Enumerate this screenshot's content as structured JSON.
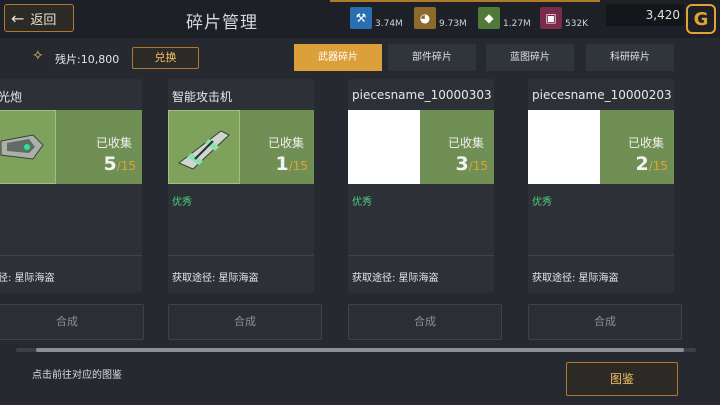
{
  "header": {
    "back_label": "返回",
    "title": "碎片管理",
    "resources": [
      {
        "icon": "wrench-icon",
        "value": "3.74M",
        "color": "#2a6fb0"
      },
      {
        "icon": "rock-icon",
        "value": "9.73M",
        "color": "#8b6a2a"
      },
      {
        "icon": "crystal-icon",
        "value": "1.27M",
        "color": "#4f7a3a"
      },
      {
        "icon": "cube-icon",
        "value": "532K",
        "color": "#7a2a4a"
      }
    ],
    "gold_value": "3,420",
    "gold_icon": "G"
  },
  "fragments": {
    "label": "残片:10,800",
    "exchange_label": "兑换"
  },
  "tabs": [
    {
      "label": "武器碎片",
      "active": true
    },
    {
      "label": "部件碎片",
      "active": false
    },
    {
      "label": "蓝图碎片",
      "active": false
    },
    {
      "label": "科研碎片",
      "active": false
    }
  ],
  "cards": [
    {
      "name": "光炮",
      "collected_label": "已收集",
      "count": "5",
      "total": "/15",
      "quality": "",
      "source": "径: 星际海盗",
      "synth_label": "合成"
    },
    {
      "name": "智能攻击机",
      "collected_label": "已收集",
      "count": "1",
      "total": "/15",
      "quality": "优秀",
      "source": "获取途径: 星际海盗",
      "synth_label": "合成"
    },
    {
      "name": "piecesname_10000303",
      "collected_label": "已收集",
      "count": "3",
      "total": "/15",
      "quality": "优秀",
      "source": "获取途径: 星际海盗",
      "synth_label": "合成"
    },
    {
      "name": "piecesname_10000203",
      "collected_label": "已收集",
      "count": "2",
      "total": "/15",
      "quality": "优秀",
      "source": "获取途径: 星际海盗",
      "synth_label": "合成"
    }
  ],
  "footer": {
    "hint": "点击前往对应的图鉴",
    "codex_label": "图鉴"
  }
}
